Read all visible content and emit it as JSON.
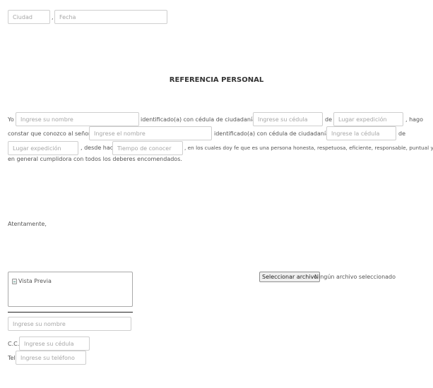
{
  "header": {
    "city_placeholder": "Ciudad",
    "separator": ",",
    "date_placeholder": "Fecha"
  },
  "title": "REFERENCIA PERSONAL",
  "body": {
    "yo": "Yo",
    "name_placeholder": "Ingrese su nombre",
    "identified_1": "identificado(a) con cédula de ciudadanía No.",
    "id_placeholder": "Ingrese su cédula",
    "de_1": "de",
    "place_placeholder_1": "Lugar expedición",
    "hago": ", hago",
    "constar": "constar que conozco al señor(a)",
    "other_name_placeholder": "Ingrese el nombre",
    "identified_2": "identificado(a) con cédula de ciudadanía No.",
    "other_id_placeholder": "Ingrese la cédula",
    "de_2": "de",
    "place_placeholder_2": "Lugar expedición",
    "desde_hace": ", desde hace",
    "time_placeholder": "Tiempo de conocer",
    "rest_line_1": ", en los cuales doy fe que es una persona honesta, respetuosa, eficiente, responsable, puntual y",
    "rest_line_2": "en general cumplidora con todos los deberes encomendados."
  },
  "closing": "Atentamente,",
  "signature": {
    "preview_alt": "Vista Previa",
    "file_button_label": "Seleccionar archivo",
    "file_status": "Ningún archivo seleccionado",
    "name_placeholder": "Ingrese su nombre",
    "cc_label": "C.C.",
    "id_placeholder": "Ingrese su cédula",
    "tel_label": "Tel.",
    "phone_placeholder": "Ingrese su teléfono"
  }
}
